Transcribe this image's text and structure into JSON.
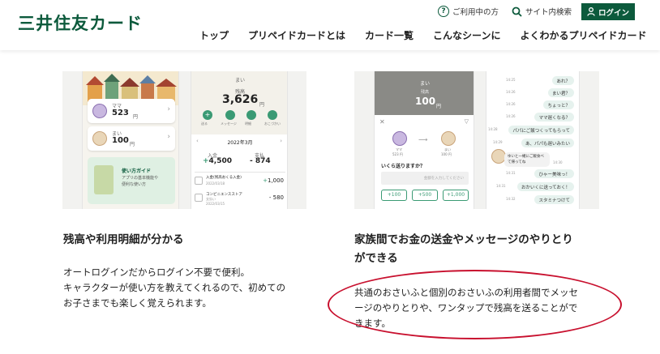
{
  "header": {
    "logo": "三井住友カード",
    "help_label": "ご利用中の方",
    "search_label": "サイト内検索",
    "login_label": "ログイン",
    "nav": [
      "トップ",
      "プリペイドカードとは",
      "カード一覧",
      "こんなシーンに",
      "よくわかるプリペイドカード"
    ]
  },
  "shot1": {
    "left_phone": {
      "member1_name": "ママ",
      "member1_amount": "523",
      "member2_name": "まい",
      "member2_amount": "100",
      "currency": "円",
      "guide_title": "使い方ガイド",
      "guide_sub1": "アプリの基本機能や",
      "guide_sub2": "便利な使い方"
    },
    "right_phone": {
      "name": "まい",
      "balance_label": "残高",
      "balance": "3,626",
      "currency": "円",
      "actions": [
        "送る",
        "メッセージ",
        "明細",
        "おこづかい"
      ],
      "month": "2022年3月",
      "in_label": "入金",
      "in_amount": "4,500",
      "out_label": "支払",
      "out_amount": "874",
      "tx1_title": "入金(残高おくる入金)",
      "tx1_date": "2022/03/18",
      "tx1_amount": "1,000",
      "tx2_title": "コンビニエンスストア",
      "tx2_sub": "支払い",
      "tx2_date": "2022/03/15",
      "tx2_amount": "580"
    }
  },
  "shot2": {
    "left_phone": {
      "name": "まい",
      "balance_label": "残高",
      "balance": "100",
      "currency": "円",
      "from_name": "ママ",
      "from_amount": "523 円",
      "to_name": "まい",
      "to_amount": "100 円",
      "question": "いくら送りますか？",
      "input_placeholder": "金額を入力してください",
      "quick_buttons": [
        "+100",
        "+500",
        "+1,000"
      ]
    },
    "chat": {
      "messages": [
        {
          "time": "14:25",
          "text": "あれ？"
        },
        {
          "time": "14:26",
          "text": "まい君？"
        },
        {
          "time": "14:26",
          "text": "ちょっと？"
        },
        {
          "time": "14:26",
          "text": "ママ遅くなる？"
        },
        {
          "time": "14:28",
          "text": "パパにご飯つくってもらって"
        },
        {
          "time": "14:29",
          "text": "あ、パパも遅いみたい"
        },
        {
          "time": "14:30",
          "text": "ゆいと一緒にご飯食べて帰ってね"
        },
        {
          "time": "14:31",
          "text": "ひゃー美味っ！"
        },
        {
          "time": "14:31",
          "text": "おかいくに送っておく！"
        },
        {
          "time": "14:32",
          "text": "スタミナつけて"
        }
      ]
    }
  },
  "feature1": {
    "title": "残高や利用明細が分かる",
    "body_line1": "オートログインだからログイン不要で便利。",
    "body_line2": "キャラクターが使い方を教えてくれるので、初めての",
    "body_line3": "お子さまでも楽しく覚えられます。"
  },
  "feature2": {
    "title_line1": "家族間でお金の送金やメッセージのやりとり",
    "title_line2": "ができる",
    "body_line1": "共通のおさいふと個別のおさいふの利用者間でメッセ",
    "body_line2": "ージのやりとりや、ワンタップで残高を送ることがで",
    "body_line3": "きます。"
  },
  "colors": {
    "brand_green": "#0c5a3c",
    "accent_green": "#3a9a74",
    "annotation_red": "#c8102e"
  }
}
